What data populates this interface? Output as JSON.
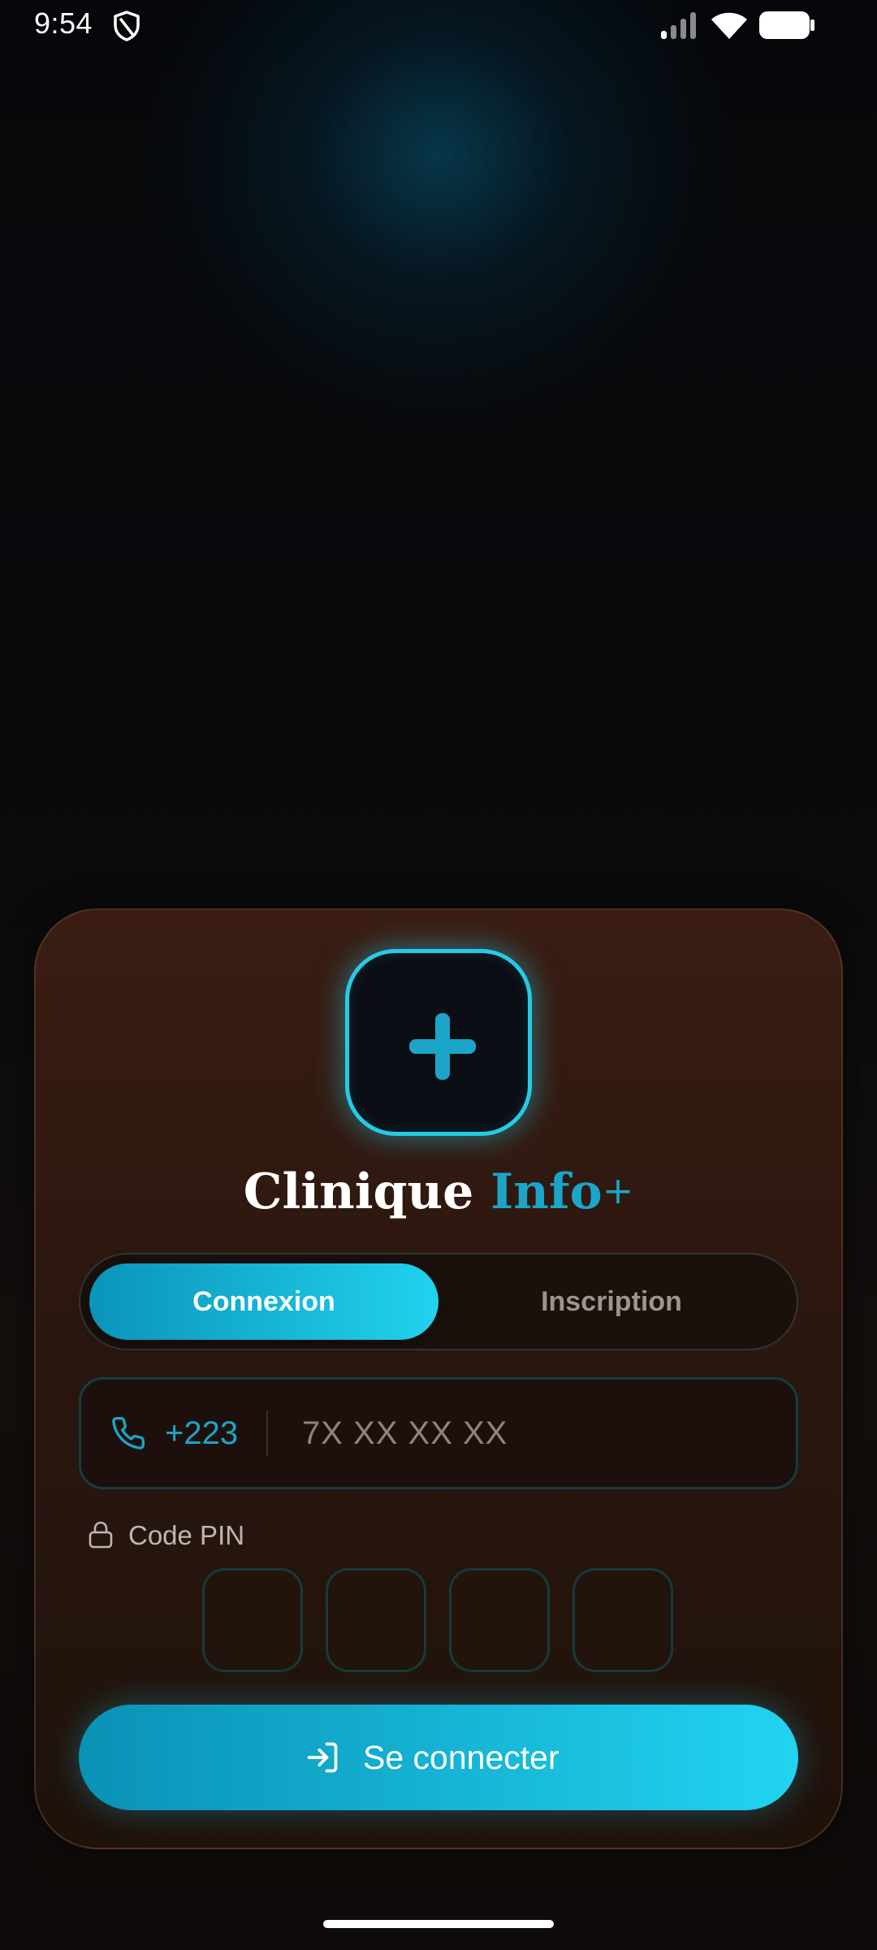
{
  "status_bar": {
    "time": "9:54",
    "icons": [
      "shield-icon",
      "signal-icon",
      "wifi-icon",
      "battery-icon"
    ]
  },
  "app": {
    "title_main": "Clinique",
    "title_accent": "Info",
    "title_plus": "+",
    "logo_icon": "medical-cross-icon"
  },
  "tabs": [
    {
      "label": "Connexion",
      "active": true
    },
    {
      "label": "Inscription",
      "active": false
    }
  ],
  "phone": {
    "country_code": "+223",
    "placeholder": "7X XX XX XX",
    "value": "",
    "icon": "phone-icon"
  },
  "pin": {
    "label": "Code PIN",
    "icon": "lock-icon",
    "digits": [
      "",
      "",
      "",
      ""
    ]
  },
  "submit": {
    "label": "Se connecter",
    "icon": "login-icon"
  },
  "colors": {
    "accent": "#1ba5c8",
    "accent_bright": "#21d2ee",
    "card_top": "#3a1c12",
    "card_bottom": "#1e120b",
    "field_border": "#163c3f"
  }
}
